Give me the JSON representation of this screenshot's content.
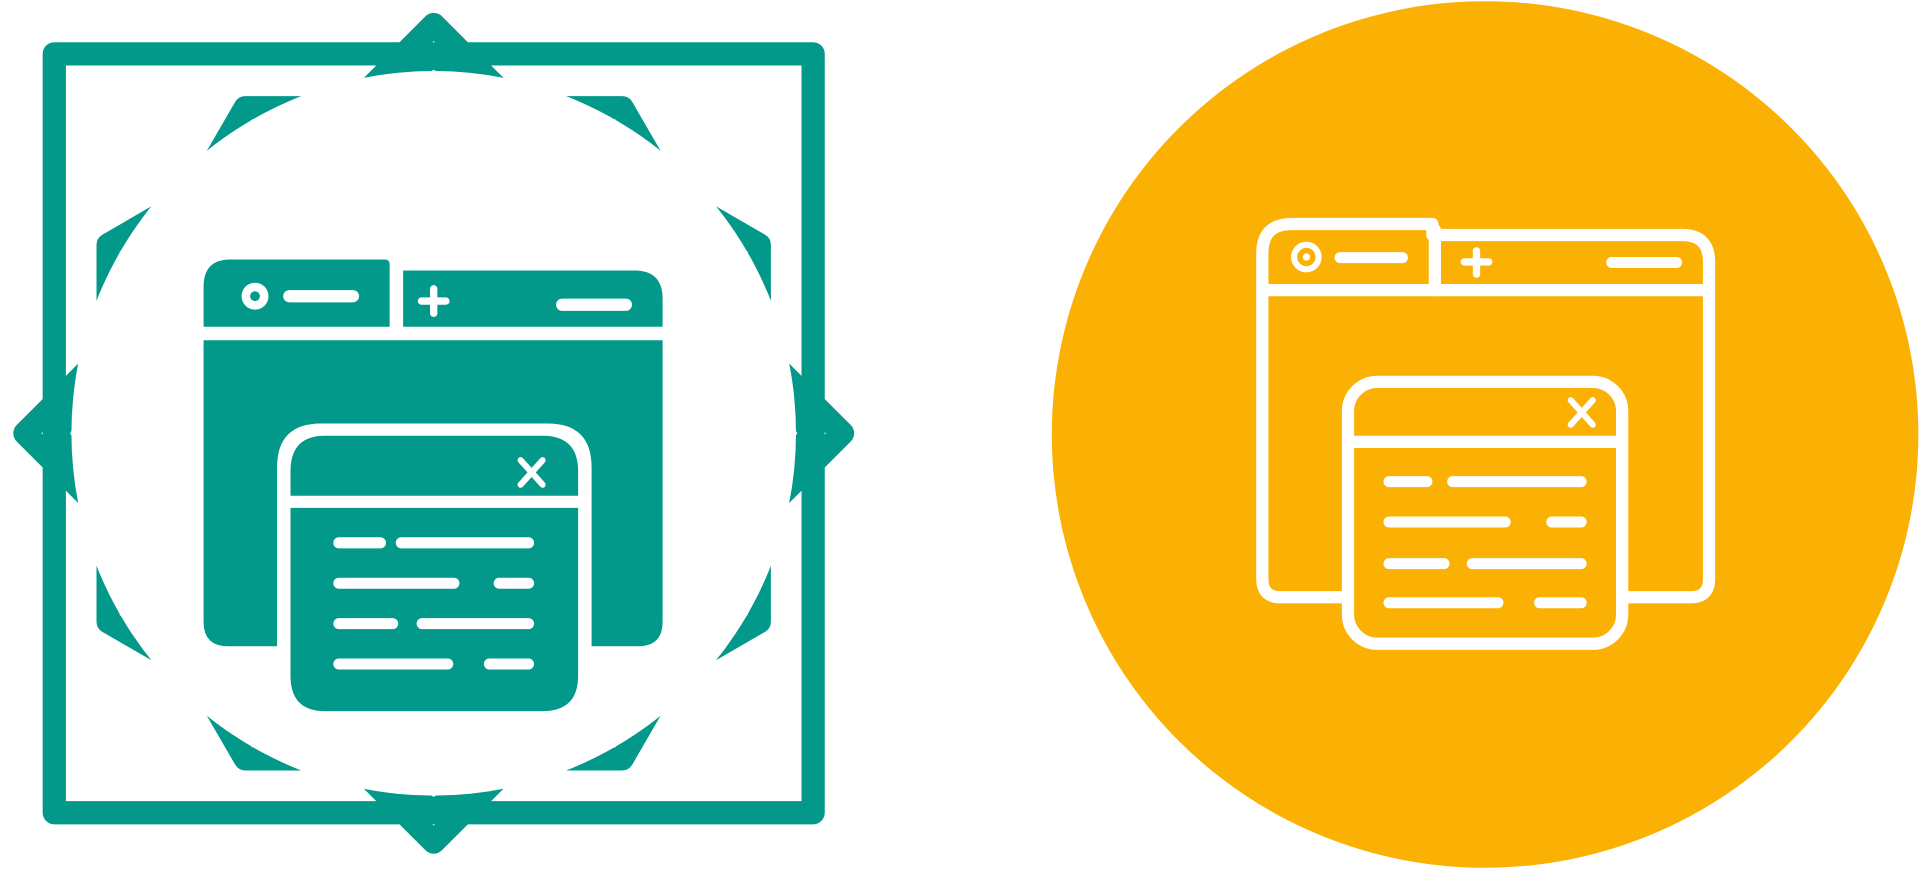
{
  "icons": [
    {
      "variant": "glyph",
      "badge": "octagram-outline-badge",
      "icon": "browser-windows-icon",
      "colors": {
        "primary": "#03998A",
        "background": "#FFFFFF"
      }
    },
    {
      "variant": "outline",
      "badge": "circle-badge",
      "icon": "browser-windows-icon",
      "colors": {
        "primary": "#FFFFFF",
        "background": "#FBB103"
      }
    }
  ]
}
